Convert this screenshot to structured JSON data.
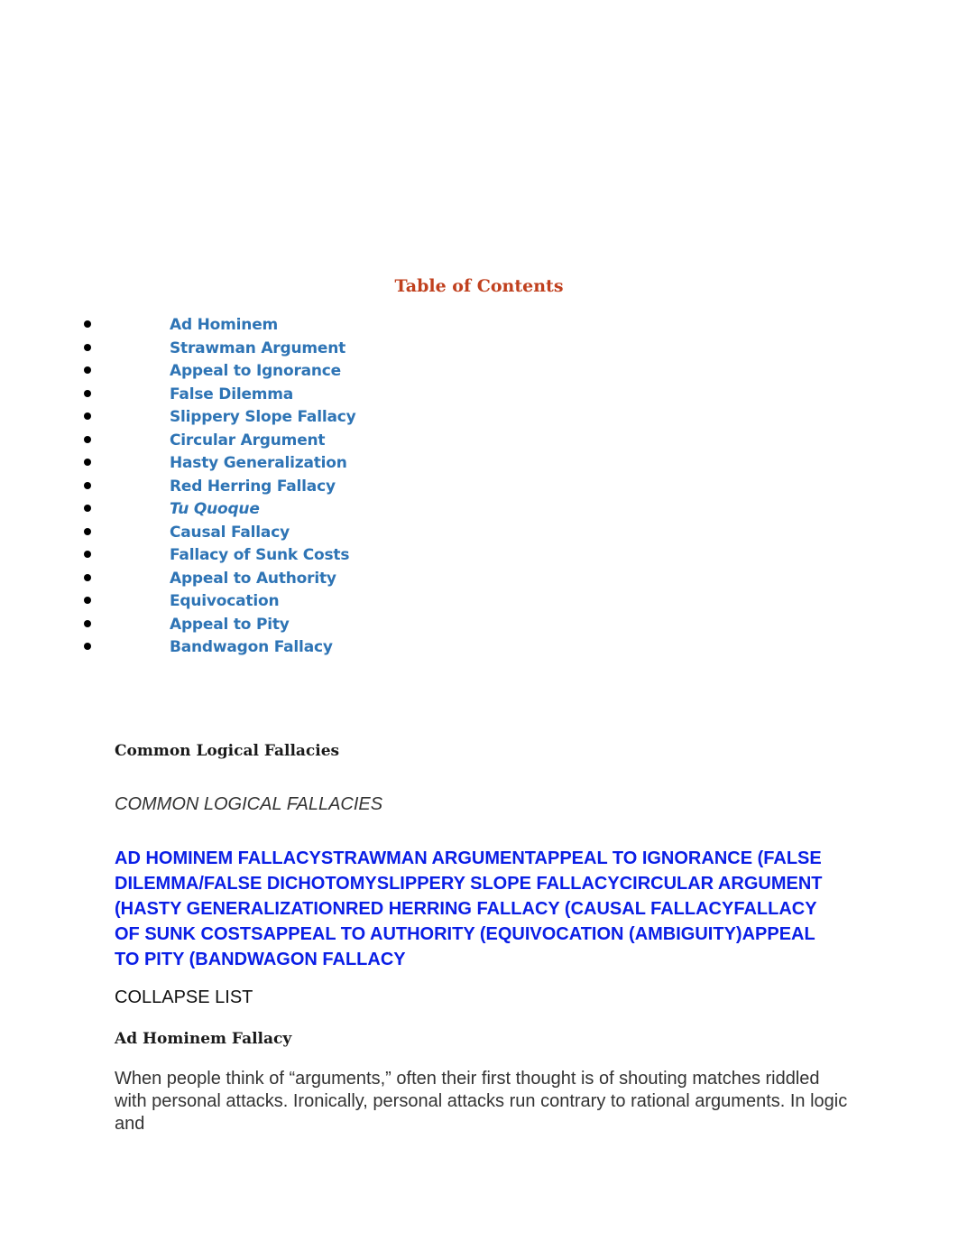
{
  "toc": {
    "title": "Table of Contents",
    "items": [
      {
        "label": "Ad Hominem",
        "italic": false
      },
      {
        "label": "Strawman Argument",
        "italic": false
      },
      {
        "label": "Appeal to Ignorance",
        "italic": false
      },
      {
        "label": "False Dilemma",
        "italic": false
      },
      {
        "label": "Slippery Slope Fallacy",
        "italic": false
      },
      {
        "label": "Circular Argument",
        "italic": false
      },
      {
        "label": "Hasty Generalization",
        "italic": false
      },
      {
        "label": "Red Herring Fallacy",
        "italic": false
      },
      {
        "label": "Tu Quoque",
        "italic": true
      },
      {
        "label": "Causal Fallacy",
        "italic": false
      },
      {
        "label": "Fallacy of Sunk Costs",
        "italic": false
      },
      {
        "label": "Appeal to Authority",
        "italic": false
      },
      {
        "label": "Equivocation",
        "italic": false
      },
      {
        "label": "Appeal to Pity",
        "italic": false
      },
      {
        "label": "Bandwagon Fallacy",
        "italic": false
      }
    ],
    "link_color": "#2e74b5",
    "title_color": "#c0401e"
  },
  "section": {
    "heading": "Common Logical Fallacies",
    "caps_heading": "COMMON LOGICAL FALLACIES",
    "caps_links": [
      "AD HOMINEM FALLACY",
      "STRAWMAN ARGUMENT",
      "APPEAL TO IGNORANCE (FALSE DILEMMA/FALSE DICHOTOMY",
      "SLIPPERY SLOPE FALLACY",
      "CIRCULAR ARGUMENT (HASTY GENERALIZATION",
      "RED HERRING FALLACY (CAUSAL FALLACY",
      "FALLACY OF SUNK COSTS",
      "APPEAL TO AUTHORITY (EQUIVOCATION (AMBIGUITY)",
      "APPEAL TO PITY (BANDWAGON FALLACY"
    ],
    "caps_link_color": "#0a1ee6",
    "collapse_label": "COLLAPSE LIST",
    "subheading": "Ad Hominem Fallacy",
    "paragraph": "When people think of “arguments,” often their first thought is of shouting matches riddled with personal attacks. Ironically, personal attacks run contrary to rational arguments. In logic and"
  }
}
